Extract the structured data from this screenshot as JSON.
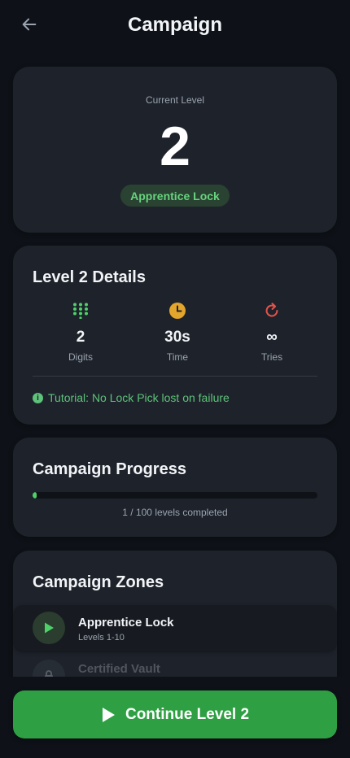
{
  "header": {
    "title": "Campaign",
    "back_icon": "arrow-left-icon"
  },
  "current_level": {
    "caption": "Current Level",
    "number": "2",
    "badge": "Apprentice Lock"
  },
  "details": {
    "title": "Level 2 Details",
    "stats": [
      {
        "icon": "keypad-grid-icon",
        "value": "2",
        "label": "Digits",
        "color": "#4fd16a"
      },
      {
        "icon": "clock-icon",
        "value": "30s",
        "label": "Time",
        "color": "#e3a52c"
      },
      {
        "icon": "retry-icon",
        "value": "∞",
        "label": "Tries",
        "color": "#e5534b"
      }
    ],
    "tutorial": "Tutorial: No Lock Pick lost on failure"
  },
  "progress": {
    "title": "Campaign Progress",
    "fraction": 0.01,
    "text": "1 / 100 levels completed"
  },
  "zones": {
    "title": "Campaign Zones",
    "items": [
      {
        "name": "Apprentice Lock",
        "sub": "Levels 1-10",
        "icon": "play-icon",
        "state": "active"
      },
      {
        "name": "Certified Vault",
        "sub": "",
        "icon": "lock-icon",
        "state": "locked"
      }
    ]
  },
  "cta": {
    "label": "Continue Level 2",
    "icon": "play-icon"
  },
  "colors": {
    "accent": "#2ea043",
    "success": "#4fd16a",
    "card": "#1e232b",
    "background": "#0e1218"
  }
}
